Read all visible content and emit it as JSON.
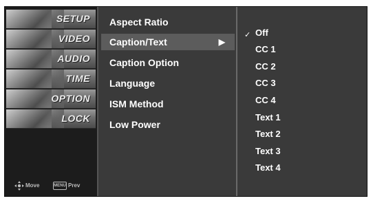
{
  "categories": [
    {
      "label": "SETUP"
    },
    {
      "label": "VIDEO"
    },
    {
      "label": "AUDIO"
    },
    {
      "label": "TIME"
    },
    {
      "label": "OPTION"
    },
    {
      "label": "LOCK"
    }
  ],
  "footer": {
    "move_label": "Move",
    "menu_key_label": "MENU",
    "prev_label": "Prev"
  },
  "options": [
    {
      "label": "Aspect Ratio"
    },
    {
      "label": "Caption/Text",
      "arrow": "▶"
    },
    {
      "label": "Caption Option"
    },
    {
      "label": "Language"
    },
    {
      "label": "ISM Method"
    },
    {
      "label": "Low Power"
    }
  ],
  "values": [
    {
      "label": "Off",
      "check": "✓"
    },
    {
      "label": "CC 1"
    },
    {
      "label": "CC 2"
    },
    {
      "label": "CC 3"
    },
    {
      "label": "CC 4"
    },
    {
      "label": "Text 1"
    },
    {
      "label": "Text 2"
    },
    {
      "label": "Text 3"
    },
    {
      "label": "Text 4"
    }
  ],
  "state": {
    "selected_category": "OPTION",
    "highlighted_option": "Caption/Text",
    "checked_value": "Off"
  },
  "colors": {
    "panel_bg": "#3a3a3a",
    "highlight_bg": "#5c5c5c",
    "text": "#ffffff"
  }
}
